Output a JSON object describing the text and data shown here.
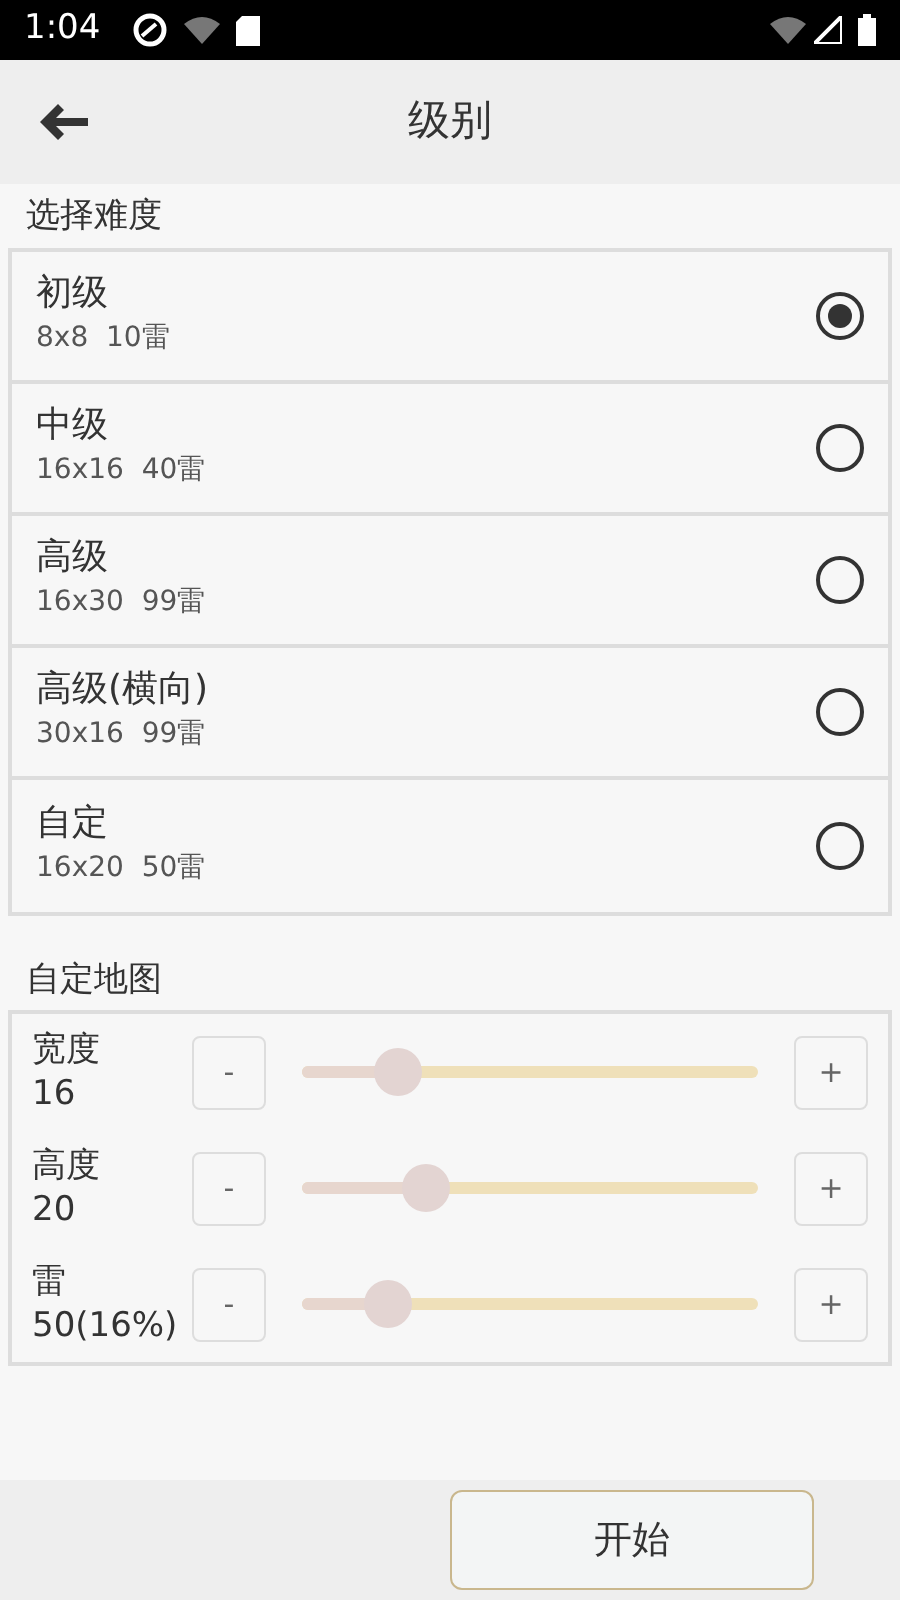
{
  "status_bar": {
    "time": "1:04"
  },
  "header": {
    "title": "级别"
  },
  "difficulty": {
    "heading": "选择难度",
    "options": [
      {
        "name": "初级",
        "detail": "8x8  10雷",
        "selected": true
      },
      {
        "name": "中级",
        "detail": "16x16  40雷",
        "selected": false
      },
      {
        "name": "高级",
        "detail": "16x30  99雷",
        "selected": false
      },
      {
        "name": "高级(横向)",
        "detail": "30x16  99雷",
        "selected": false
      },
      {
        "name": "自定",
        "detail": "16x20  50雷",
        "selected": false
      }
    ]
  },
  "custom_map": {
    "heading": "自定地图",
    "sliders": [
      {
        "label": "宽度",
        "value": "16",
        "minus": "-",
        "plus": "+",
        "level": 0.21
      },
      {
        "label": "高度",
        "value": "20",
        "minus": "-",
        "plus": "+",
        "level": 0.27
      },
      {
        "label": "雷",
        "value": "50(16%)",
        "minus": "-",
        "plus": "+",
        "level": 0.19
      }
    ]
  },
  "start_button": "开始"
}
